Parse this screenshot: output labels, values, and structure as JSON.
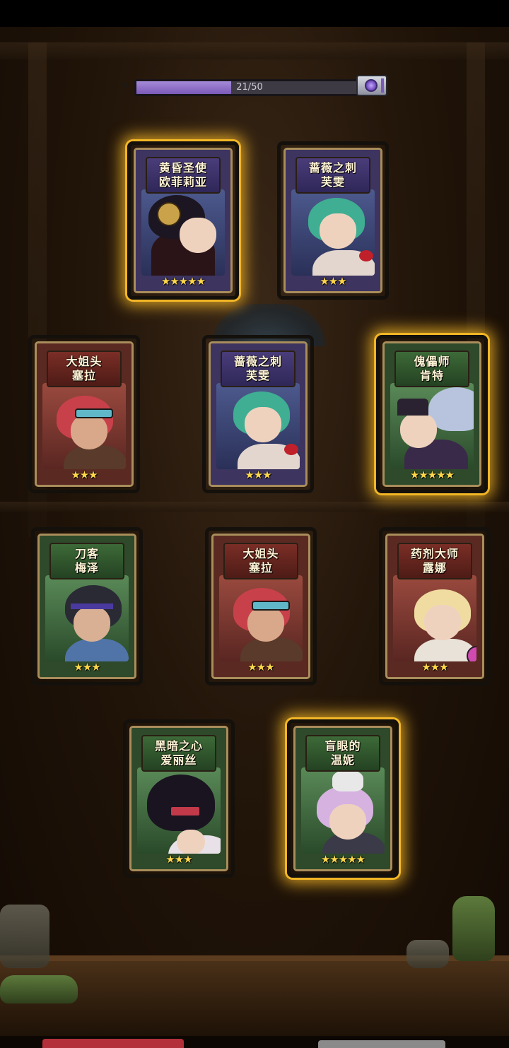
{
  "progress": {
    "text": "21/50",
    "value": 21,
    "max": 50,
    "fill_color": "#8f6fcb",
    "reward_icon": "chest-icon"
  },
  "cards": [
    {
      "title": "黄昏圣使",
      "name": "欧菲莉亚",
      "stars": "★★★★★",
      "star_count": 5,
      "theme": "purple",
      "highlight": true
    },
    {
      "title": "蔷薇之刺",
      "name": "芙雯",
      "stars": "★★★",
      "star_count": 3,
      "theme": "purple",
      "highlight": false
    },
    {
      "title": "大姐头",
      "name": "塞拉",
      "stars": "★★★",
      "star_count": 3,
      "theme": "red",
      "highlight": false
    },
    {
      "title": "蔷薇之刺",
      "name": "芙雯",
      "stars": "★★★",
      "star_count": 3,
      "theme": "purple",
      "highlight": false
    },
    {
      "title": "傀儡师",
      "name": "肯特",
      "stars": "★★★★★",
      "star_count": 5,
      "theme": "green",
      "highlight": true
    },
    {
      "title": "刀客",
      "name": "梅泽",
      "stars": "★★★",
      "star_count": 3,
      "theme": "green",
      "highlight": false
    },
    {
      "title": "大姐头",
      "name": "塞拉",
      "stars": "★★★",
      "star_count": 3,
      "theme": "red",
      "highlight": false
    },
    {
      "title": "药剂大师",
      "name": "露娜",
      "stars": "★★★",
      "star_count": 3,
      "theme": "red",
      "highlight": false
    },
    {
      "title": "黑暗之心",
      "name": "爱丽丝",
      "stars": "★★★",
      "star_count": 3,
      "theme": "green",
      "highlight": false
    },
    {
      "title": "盲眼的",
      "name": "温妮",
      "stars": "★★★★★",
      "star_count": 5,
      "theme": "green",
      "highlight": true
    }
  ],
  "colors": {
    "gold_glow": "#f2b626",
    "star": "#ffd84a"
  }
}
